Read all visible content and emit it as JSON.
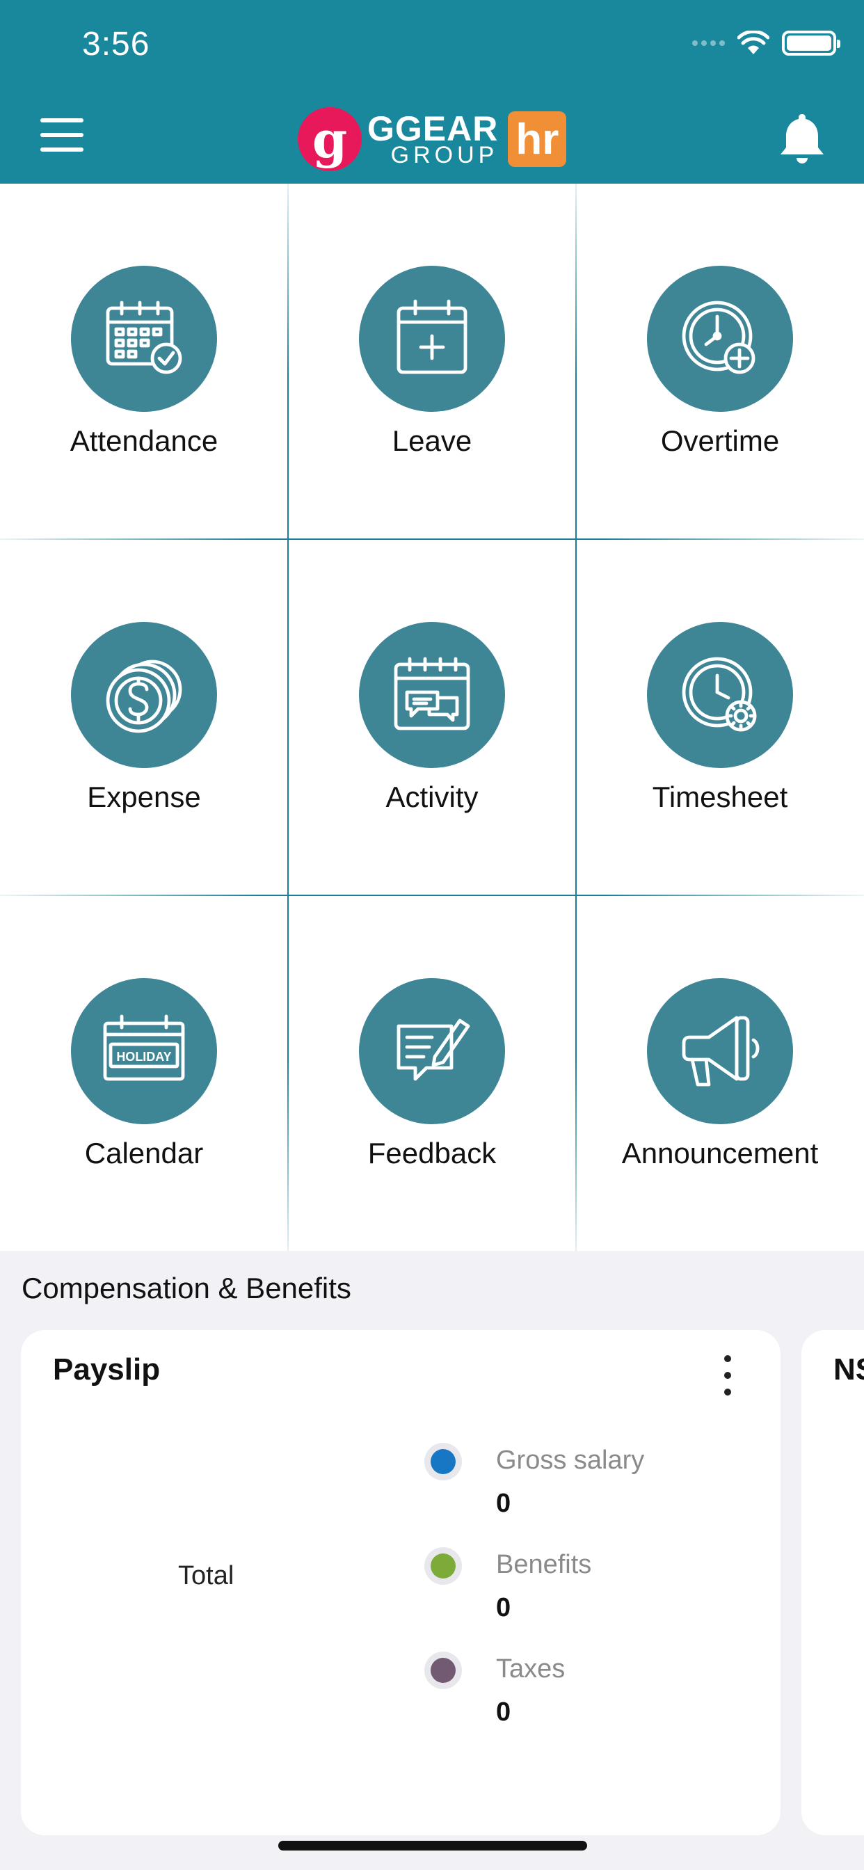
{
  "status_bar": {
    "time": "3:56"
  },
  "header": {
    "logo_letter": "g",
    "logo_name": "GGEAR",
    "logo_group": "GROUP",
    "logo_badge": "hr",
    "colors": {
      "background": "#1a889c",
      "logo_red": "#e8195a",
      "logo_orange": "#f08f35"
    }
  },
  "tiles": [
    {
      "label": "Attendance",
      "icon": "calendar-check-icon"
    },
    {
      "label": "Leave",
      "icon": "calendar-plus-icon"
    },
    {
      "label": "Overtime",
      "icon": "clock-plus-icon"
    },
    {
      "label": "Expense",
      "icon": "coins-dollar-icon"
    },
    {
      "label": "Activity",
      "icon": "calendar-chat-icon"
    },
    {
      "label": "Timesheet",
      "icon": "clock-gear-icon"
    },
    {
      "label": "Calendar",
      "icon": "holiday-calendar-icon"
    },
    {
      "label": "Feedback",
      "icon": "feedback-edit-icon"
    },
    {
      "label": "Announcement",
      "icon": "megaphone-icon"
    }
  ],
  "tile_icon_color": "#3e8696",
  "holiday_text": "HOLIDAY",
  "compensation": {
    "section_title": "Compensation & Benefits",
    "payslip": {
      "title": "Payslip",
      "total_label": "Total",
      "legend": [
        {
          "name": "Gross salary",
          "value": "0",
          "color": "#1777c4"
        },
        {
          "name": "Benefits",
          "value": "0",
          "color": "#7cab3a"
        },
        {
          "name": "Taxes",
          "value": "0",
          "color": "#735a73"
        }
      ]
    },
    "next_card_title": "NS"
  }
}
